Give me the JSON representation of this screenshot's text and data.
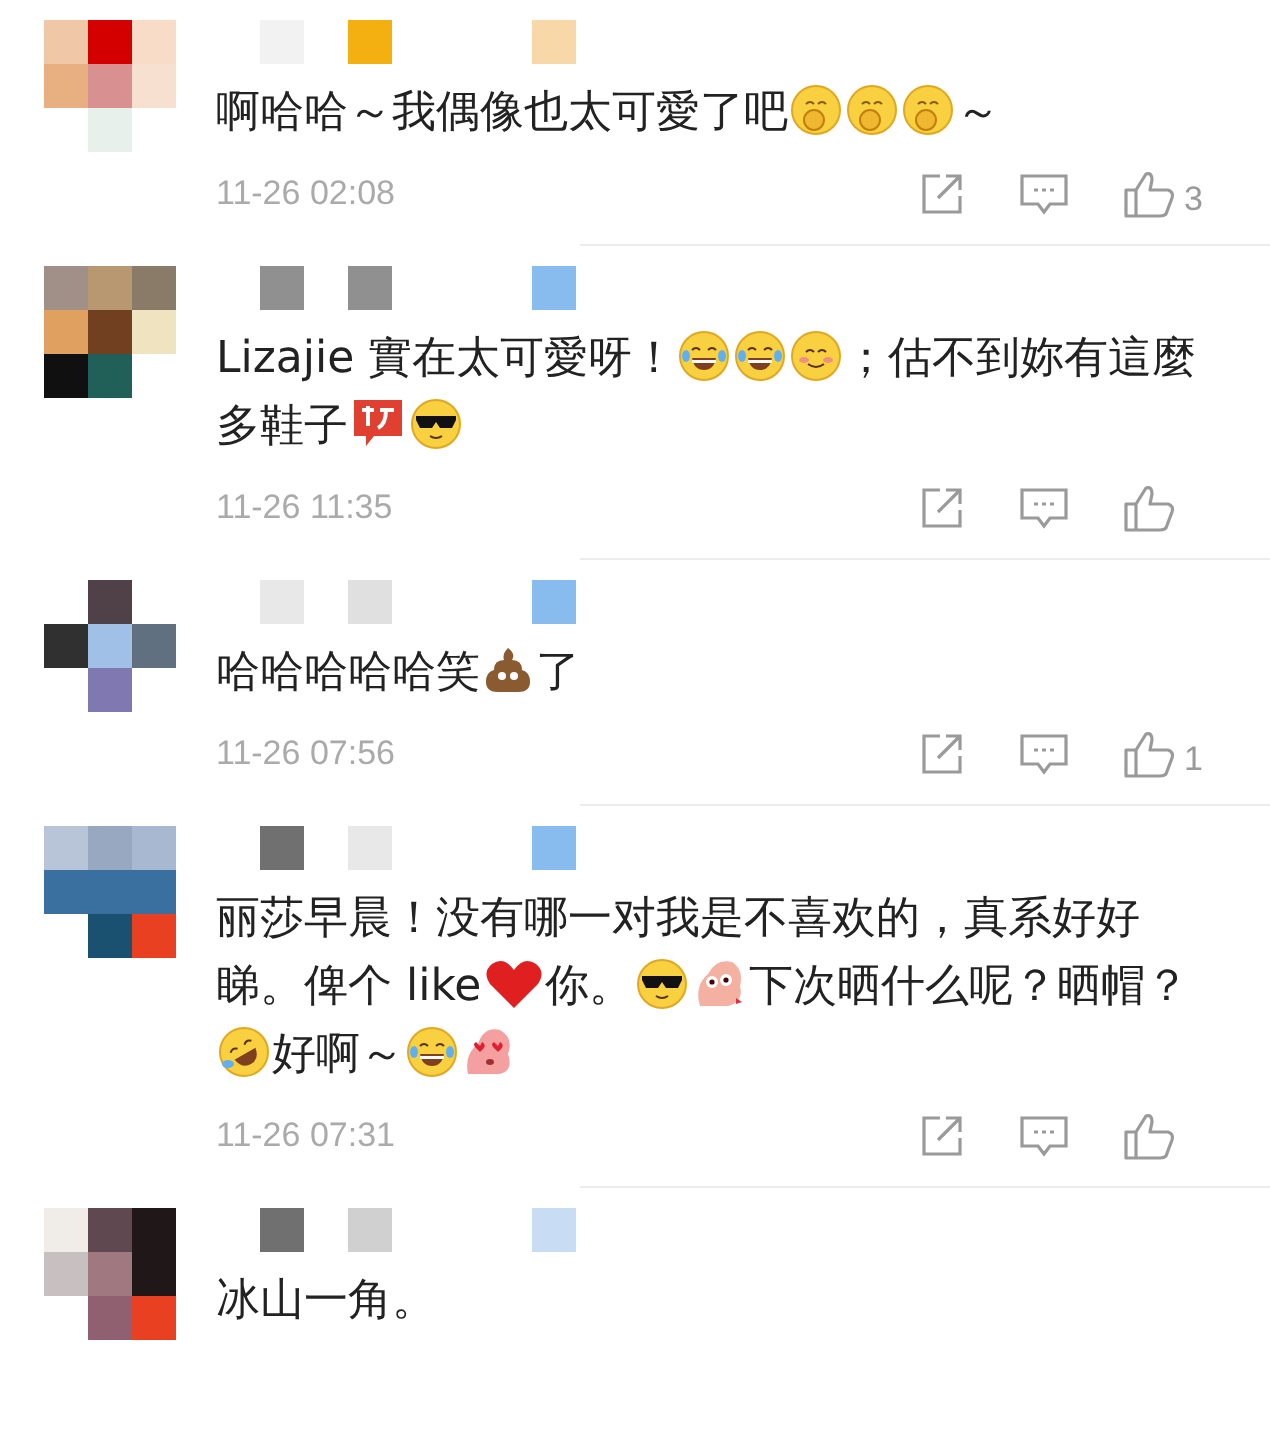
{
  "comments": [
    {
      "avatar": {
        "kind": "picture"
      },
      "name": {
        "kind": "picture"
      },
      "segments": [
        {
          "kind": "text",
          "text": "啊哈哈～我偶像也太可愛了吧"
        },
        {
          "kind": "think"
        },
        {
          "kind": "think"
        },
        {
          "kind": "think"
        },
        {
          "kind": "text",
          "text": "～"
        }
      ],
      "time": "11-26 02:08",
      "likes": "3"
    },
    {
      "avatar": {
        "kind": "picture"
      },
      "name": {
        "kind": "picture"
      },
      "segments": [
        {
          "kind": "text",
          "text": "Lizajie 實在太可愛呀！"
        },
        {
          "kind": "laugh"
        },
        {
          "kind": "laugh"
        },
        {
          "kind": "smile"
        },
        {
          "kind": "text",
          "text": "；估不到妳有這麼多鞋子"
        },
        {
          "kind": "badge"
        },
        {
          "kind": "cool"
        }
      ],
      "time": "11-26 11:35"
    },
    {
      "avatar": {
        "kind": "picture"
      },
      "name": {
        "kind": "picture"
      },
      "segments": [
        {
          "kind": "text",
          "text": "哈哈哈哈哈笑"
        },
        {
          "kind": "poop"
        },
        {
          "kind": "text",
          "text": "了"
        }
      ],
      "time": "11-26 07:56",
      "likes": "1"
    },
    {
      "avatar": {
        "kind": "picture"
      },
      "name": {
        "kind": "picture"
      },
      "segments": [
        {
          "kind": "text",
          "text": "丽莎早晨！没有哪一对我是不喜欢的，真系好好睇。俾个 like"
        },
        {
          "kind": "heart"
        },
        {
          "kind": "text",
          "text": "你。"
        },
        {
          "kind": "cool"
        },
        {
          "kind": "pig"
        },
        {
          "kind": "text",
          "text": "下次晒什么呢？晒帽？"
        },
        {
          "kind": "roll"
        },
        {
          "kind": "text",
          "text": "好啊～"
        },
        {
          "kind": "laugh"
        },
        {
          "kind": "pig-love"
        }
      ],
      "time": "11-26 07:31"
    },
    {
      "avatar": {
        "kind": "picture"
      },
      "name": {
        "kind": "picture"
      },
      "segments": [
        {
          "kind": "text",
          "text": "冰山一角。"
        }
      ]
    }
  ]
}
